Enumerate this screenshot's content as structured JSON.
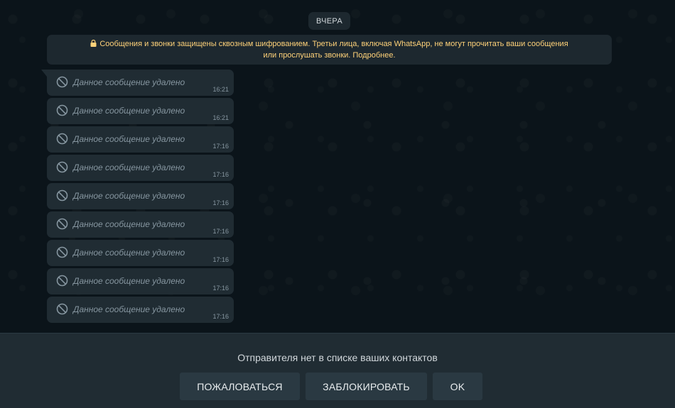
{
  "chat": {
    "date_chip": "ВЧЕРА",
    "e2e_notice": {
      "line1": "Сообщения и звонки защищены сквозным шифрованием. Третьи лица, включая WhatsApp, не могут прочитать ваши сообщения",
      "line2": "или прослушать звонки. Подробнее.",
      "icon": "lock-icon",
      "color": "#ffd279"
    },
    "messages": [
      {
        "text": "Данное сообщение удалено",
        "time": "16:21"
      },
      {
        "text": "Данное сообщение удалено",
        "time": "16:21"
      },
      {
        "text": "Данное сообщение удалено",
        "time": "17:16"
      },
      {
        "text": "Данное сообщение удалено",
        "time": "17:16"
      },
      {
        "text": "Данное сообщение удалено",
        "time": "17:16"
      },
      {
        "text": "Данное сообщение удалено",
        "time": "17:16"
      },
      {
        "text": "Данное сообщение удалено",
        "time": "17:16"
      },
      {
        "text": "Данное сообщение удалено",
        "time": "17:16"
      },
      {
        "text": "Данное сообщение удалено",
        "time": "17:16"
      }
    ]
  },
  "footer": {
    "prompt": "Отправителя нет в списке ваших контактов",
    "report_label": "ПОЖАЛОВАТЬСЯ",
    "block_label": "ЗАБЛОКИРОВАТЬ",
    "ok_label": "OK"
  },
  "colors": {
    "background": "#0b141a",
    "bubble": "#202c33",
    "muted_text": "#8696a0",
    "panel": "#202c33",
    "button": "#2a3942"
  }
}
